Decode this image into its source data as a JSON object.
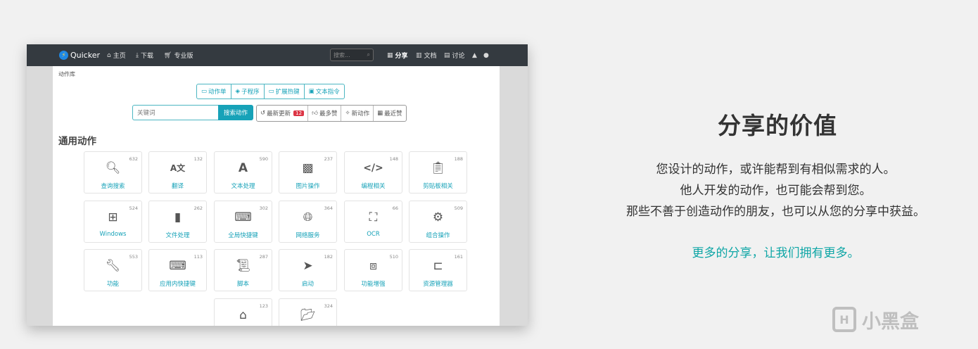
{
  "navbar": {
    "brand": "Quicker",
    "home": "主页",
    "download": "下载",
    "pro": "专业版",
    "search_placeholder": "搜索...",
    "share": "分享",
    "docs": "文档",
    "discuss": "讨论"
  },
  "breadcrumb": "动作库",
  "tabs": [
    {
      "label": "动作单",
      "icon": "list-icon"
    },
    {
      "label": "子程序",
      "icon": "cube-icon"
    },
    {
      "label": "扩展热键",
      "icon": "keyboard-icon"
    },
    {
      "label": "文本指令",
      "icon": "terminal-icon"
    }
  ],
  "search": {
    "placeholder": "关键词",
    "button": "搜索动作"
  },
  "sorts": [
    {
      "label": "最新更新",
      "icon": "history-icon",
      "badge": "12"
    },
    {
      "label": "最多赞",
      "icon": "thumbs-up-icon"
    },
    {
      "label": "新动作",
      "icon": "sparkle-icon"
    },
    {
      "label": "最近赞",
      "icon": "calendar-icon"
    }
  ],
  "section_title": "通用动作",
  "cards": [
    {
      "label": "查询搜索",
      "count": "632",
      "icon": "search-icon"
    },
    {
      "label": "翻译",
      "count": "132",
      "icon": "translate-icon"
    },
    {
      "label": "文本处理",
      "count": "590",
      "icon": "font-icon"
    },
    {
      "label": "图片操作",
      "count": "237",
      "icon": "images-icon"
    },
    {
      "label": "编程相关",
      "count": "148",
      "icon": "code-icon"
    },
    {
      "label": "剪贴板相关",
      "count": "188",
      "icon": "clipboard-icon"
    },
    {
      "label": "Windows",
      "count": "524",
      "icon": "windows-icon"
    },
    {
      "label": "文件处理",
      "count": "262",
      "icon": "file-icon"
    },
    {
      "label": "全局快捷键",
      "count": "302",
      "icon": "keyboard-icon"
    },
    {
      "label": "网络服务",
      "count": "364",
      "icon": "globe-icon"
    },
    {
      "label": "OCR",
      "count": "66",
      "icon": "expand-icon"
    },
    {
      "label": "组合操作",
      "count": "509",
      "icon": "gears-icon"
    },
    {
      "label": "功能",
      "count": "553",
      "icon": "wrench-icon"
    },
    {
      "label": "应用内快捷键",
      "count": "113",
      "icon": "keyboard-icon"
    },
    {
      "label": "脚本",
      "count": "287",
      "icon": "scroll-icon"
    },
    {
      "label": "启动",
      "count": "182",
      "icon": "paper-plane-icon"
    },
    {
      "label": "功能增强",
      "count": "510",
      "icon": "cubes-icon"
    },
    {
      "label": "资源管理器",
      "count": "161",
      "icon": "folder-tree-icon"
    },
    {
      "label": "",
      "count": "123",
      "icon": "presentation-icon"
    },
    {
      "label": "",
      "count": "324",
      "icon": "folder-open-icon"
    }
  ],
  "right": {
    "heading": "分享的价值",
    "lines": [
      "您设计的动作，或许能帮到有相似需求的人。",
      "他人开发的动作，也可能会帮到您。",
      "那些不善于创造动作的朋友，也可以从您的分享中获益。"
    ],
    "highlight": "更多的分享，让我们拥有更多。"
  },
  "watermark": "小黑盒",
  "colors": {
    "accent": "#17a2b8",
    "navbar": "#343a40",
    "highlight": "#0fa6a6"
  }
}
